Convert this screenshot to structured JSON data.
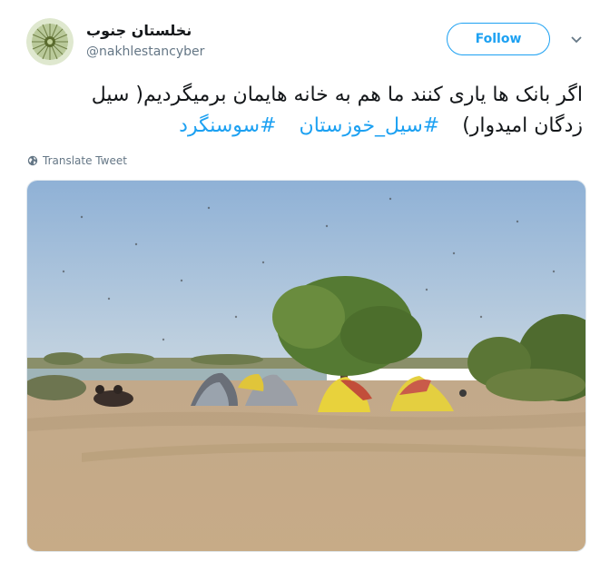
{
  "user": {
    "display_name": "نخلستان جنوب",
    "handle": "@nakhlestancyber",
    "avatar_icon": "dandelion-avatar"
  },
  "follow": {
    "label": "Follow",
    "color": "#1da1f2"
  },
  "menu": {
    "icon": "chevron-down-icon"
  },
  "tweet": {
    "line1": "اگر بانک ها یاری کنند ما هم به خانه هایمان برمیگردیم( سیل",
    "line2_text": "زدگان امیدوار)",
    "hashtags": [
      "#سیل_خوزستان",
      "#سوسنگرد"
    ]
  },
  "translate": {
    "label": "Translate Tweet",
    "icon": "globe-icon"
  },
  "media": {
    "description_icon": "photo-camp-tents"
  }
}
